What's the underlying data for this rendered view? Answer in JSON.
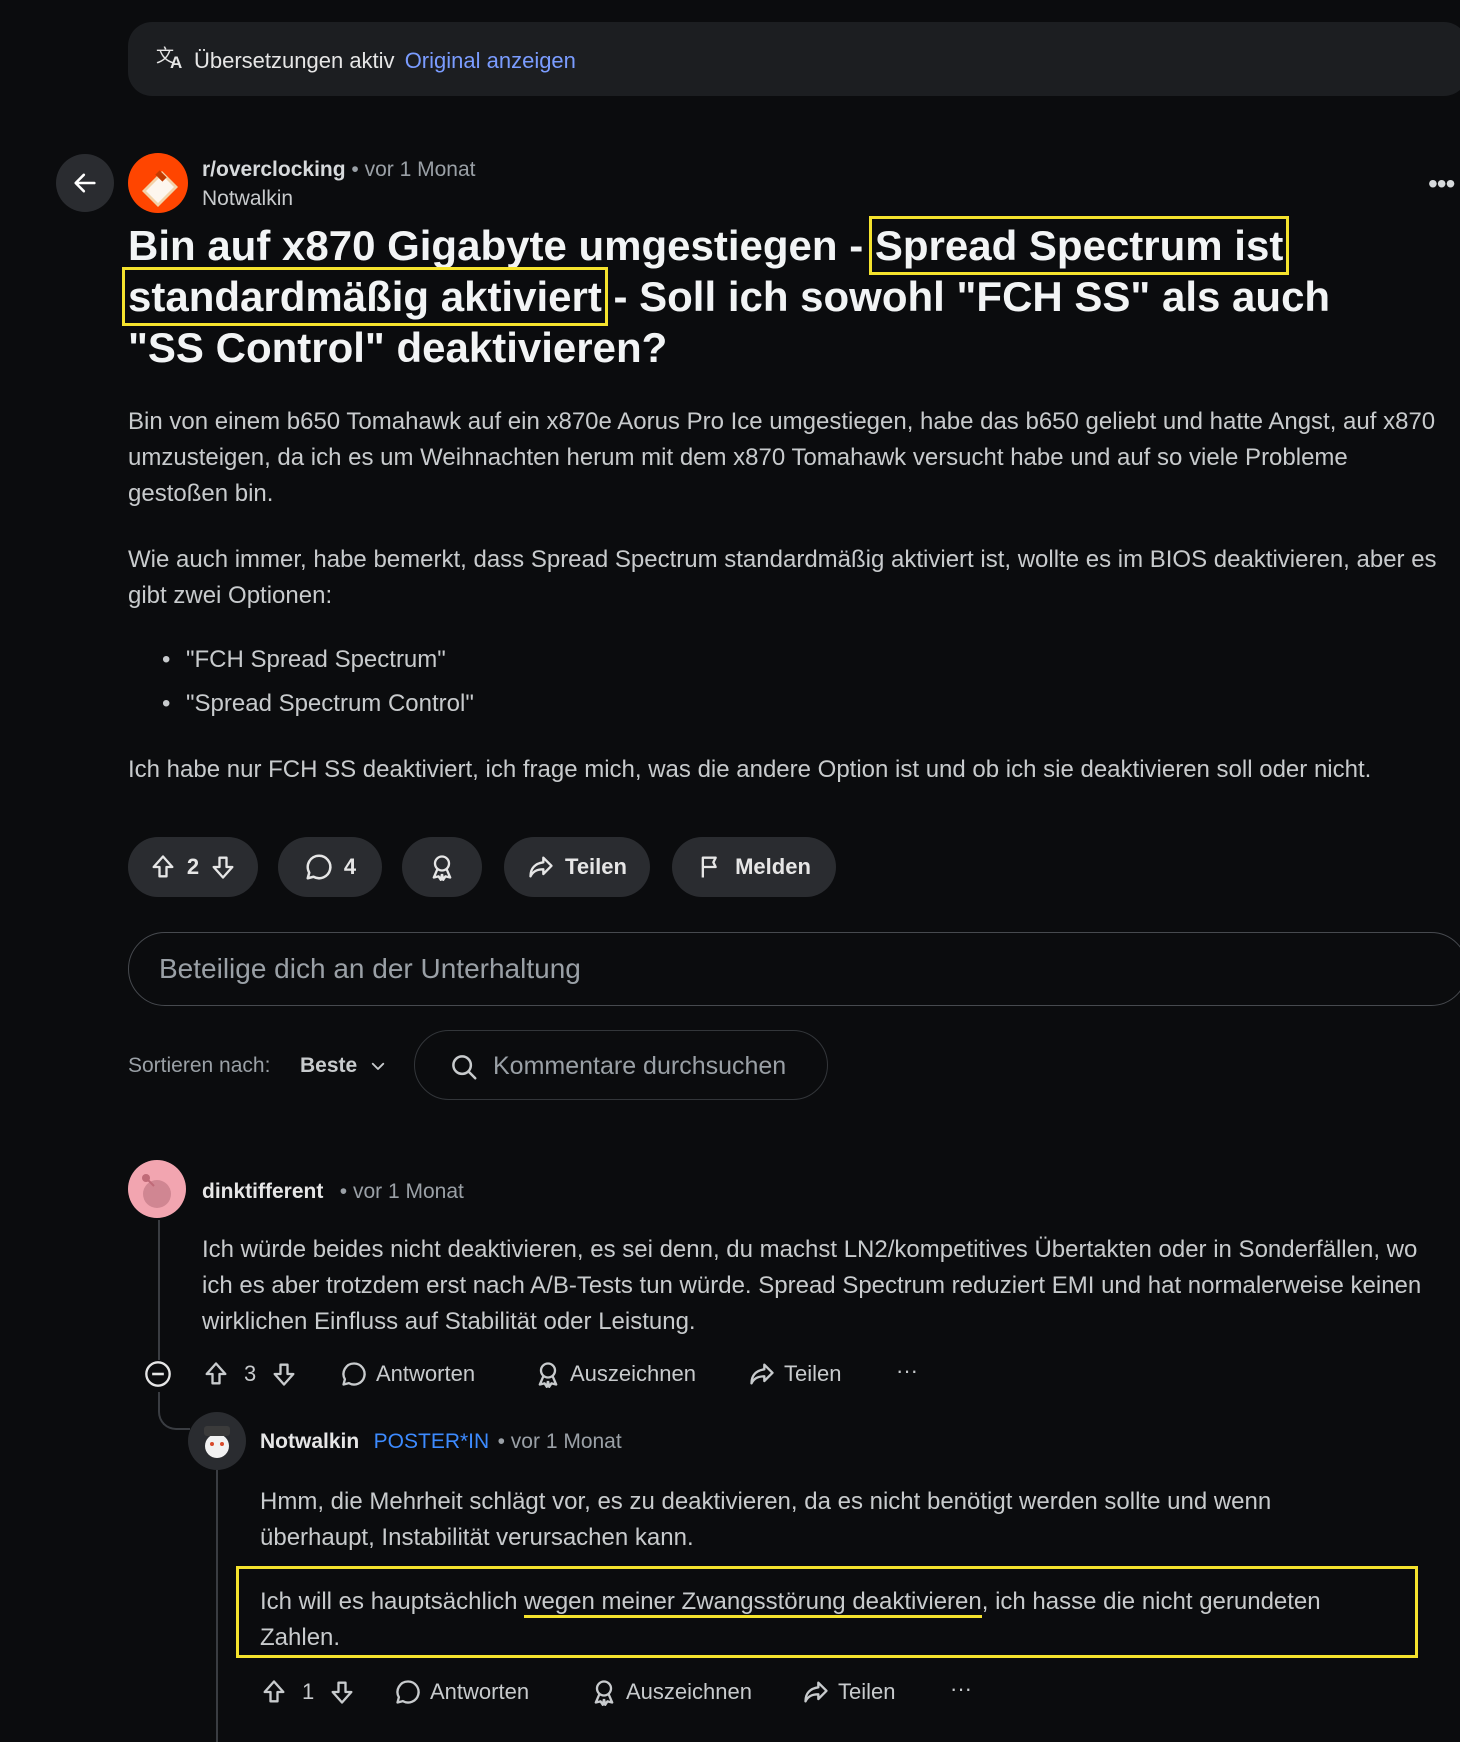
{
  "banner": {
    "text": "Übersetzungen aktiv",
    "link": "Original anzeigen"
  },
  "post": {
    "subreddit": "r/overclocking",
    "time": "• vor 1 Monat",
    "author": "Notwalkin",
    "title_part1": "Bin auf x870 Gigabyte umgestiegen - ",
    "title_hl1": "Spread Spectrum ist",
    "title_hl2": "standardmäßig aktiviert",
    "title_part2": "- Soll ich sowohl \"FCH SS\" als auch \"SS Control\" deaktivieren?",
    "para1": "Bin von einem b650 Tomahawk auf ein x870e Aorus Pro Ice umgestiegen, habe das b650 geliebt und hatte Angst, auf x870 umzusteigen, da ich es um Weihnachten herum mit dem x870 Tomahawk versucht habe und auf so viele Probleme gestoßen bin.",
    "para2": "Wie auch immer, habe bemerkt, dass Spread Spectrum standardmäßig aktiviert ist, wollte es im BIOS deaktivieren, aber es gibt zwei Optionen:",
    "bullets": [
      "\"FCH Spread Spectrum\"",
      "\"Spread Spectrum Control\""
    ],
    "para3": "Ich habe nur FCH SS deaktiviert, ich frage mich, was die andere Option ist und ob ich sie deaktivieren soll oder nicht.",
    "votes": "2",
    "comments": "4",
    "share": "Teilen",
    "report": "Melden"
  },
  "compose": {
    "placeholder": "Beteilige dich an der Unterhaltung"
  },
  "sort": {
    "label": "Sortieren nach:",
    "value": "Beste",
    "search_placeholder": "Kommentare durchsuchen"
  },
  "comments": [
    {
      "user": "dinktifferent",
      "time": "• vor 1 Monat",
      "text": "Ich würde beides nicht deaktivieren, es sei denn, du machst LN2/kompetitives Übertakten oder in Sonderfällen, wo ich es aber trotzdem erst nach A/B-Tests tun würde. Spread Spectrum reduziert EMI und hat normalerweise keinen wirklichen Einfluss auf Stabilität oder Leistung.",
      "votes": "3"
    },
    {
      "user": "Notwalkin",
      "badge": "POSTER*IN",
      "time": "• vor 1 Monat",
      "text1": "Hmm, die Mehrheit schlägt vor, es zu deaktivieren, da es nicht benötigt werden sollte und wenn überhaupt, Instabilität verursachen kann.",
      "text2_a": "Ich will es hauptsächlich ",
      "text2_ul": "wegen meiner Zwangsstörung deaktivieren",
      "text2_b": ", ich hasse die nicht gerundeten Zahlen.",
      "votes": "1"
    }
  ],
  "actions": {
    "reply": "Antworten",
    "award": "Auszeichnen",
    "share": "Teilen",
    "more": "···"
  },
  "colors": {
    "highlight": "#f5e32d",
    "link": "#7a9cff",
    "badge": "#3d8bff",
    "background": "#0b0c0e"
  }
}
